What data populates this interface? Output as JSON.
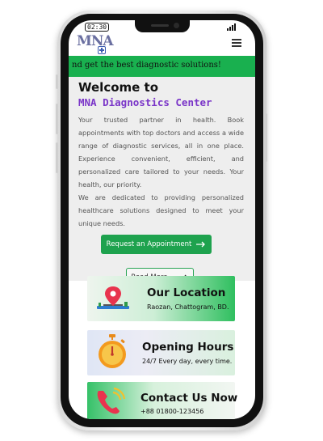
{
  "status": {
    "time": "02:30"
  },
  "logo": {
    "text": "MNA"
  },
  "ticker": {
    "text": "nd get the best diagnostic solutions!"
  },
  "hero": {
    "welcome": "Welcome to",
    "center_name": "MNA Diagnostics Center",
    "intro_1": "Your trusted partner in health. Book appointments with top doctors and access a wide range of diagnostic services, all in one place. Experience convenient, efficient, and personalized care tailored to your needs. Your health, our priority.",
    "intro_2": "We are dedicated to providing personalized healthcare solutions designed to meet your unique needs.",
    "request_label": "Request an Appointment",
    "read_more_label": "Read More..."
  },
  "cards": {
    "location": {
      "title": "Our Location",
      "subtitle": "Raozan, Chattogram, BD."
    },
    "hours": {
      "title": "Opening Hours",
      "subtitle": "24/7 Every day, every time."
    },
    "contact": {
      "title": "Contact Us Now",
      "subtitle": "+88 01800-123456"
    }
  },
  "colors": {
    "brand_green": "#1ea24e",
    "ticker_green": "#19b04f",
    "accent_purple": "#7a35c8"
  },
  "icons": [
    "menu-icon",
    "arrow-right-icon",
    "location-pin-icon",
    "stopwatch-icon",
    "phone-icon"
  ]
}
